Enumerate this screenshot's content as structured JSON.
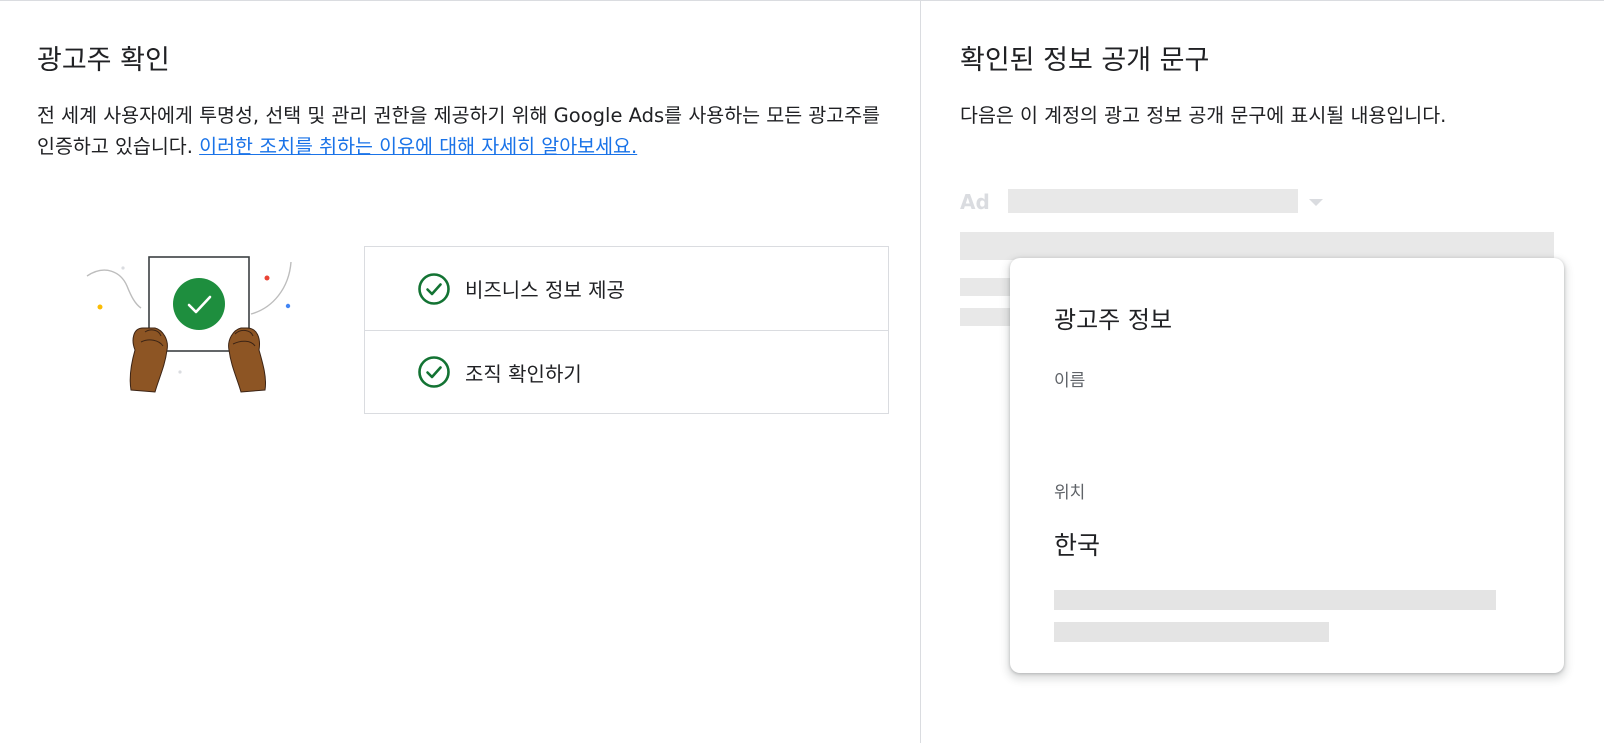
{
  "left": {
    "title": "광고주 확인",
    "description": "전 세계 사용자에게 투명성, 선택 및 관리 권한을 제공하기 위해 Google Ads를 사용하는 모든 광고주를 인증하고 있습니다. ",
    "learn_more_link": "이러한 조치를 취하는 이유에 대해 자세히 알아보세요.",
    "steps": [
      {
        "label": "비즈니스 정보 제공",
        "icon": "check-circle-icon",
        "status": "complete"
      },
      {
        "label": "조직 확인하기",
        "icon": "check-circle-icon",
        "status": "complete"
      }
    ]
  },
  "right": {
    "title": "확인된 정보 공개 문구",
    "description": "다음은 이 계정의 광고 정보 공개 문구에 표시될 내용입니다.",
    "ad_label": "Ad",
    "card": {
      "title": "광고주 정보",
      "name_label": "이름",
      "name_value": "",
      "location_label": "위치",
      "location_value": "한국"
    }
  },
  "colors": {
    "link": "#1a73e8",
    "check_green": "#137333",
    "illustration_green": "#1e8e3e",
    "divider": "#dadce0",
    "placeholder_bar": "#e4e4e4"
  }
}
